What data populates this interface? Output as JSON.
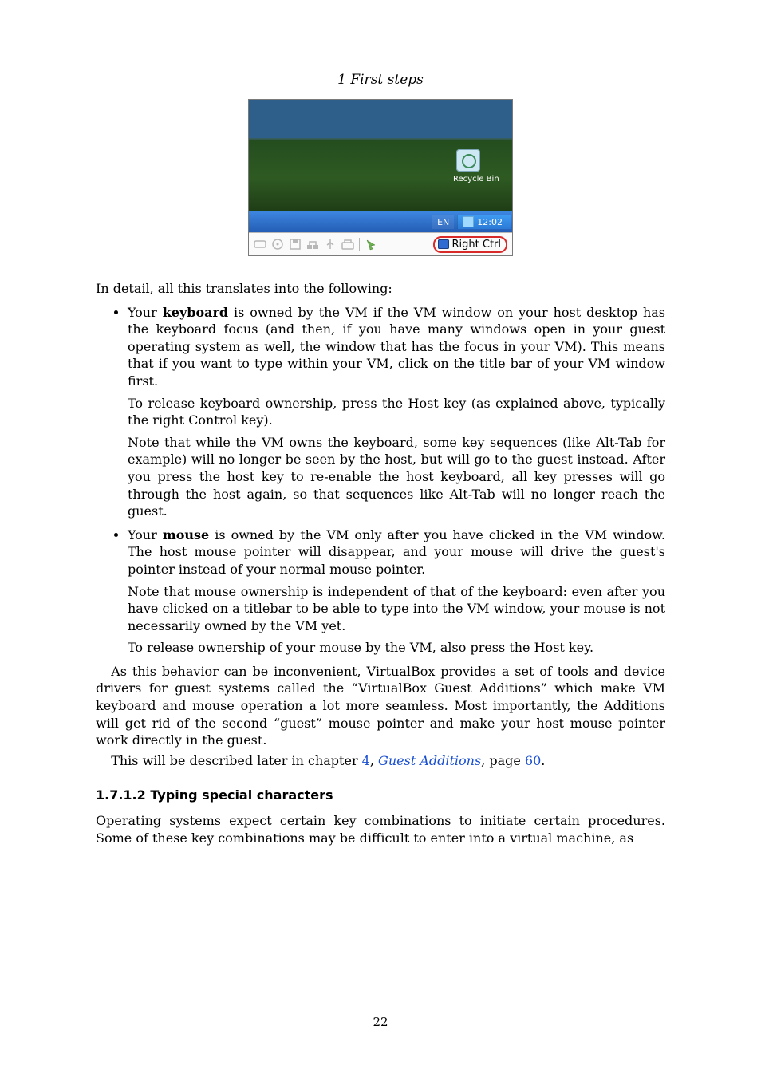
{
  "running_head": "1 First steps",
  "figure": {
    "recycle_label": "Recycle Bin",
    "lang": "EN",
    "clock": "12:02",
    "host_key": "Right Ctrl"
  },
  "intro": "In detail, all this translates into the following:",
  "bullets": {
    "kb": {
      "lead_pre": "Your ",
      "lead_bold": "keyboard",
      "lead_post": " is owned by the VM if the VM window on your host desktop has the keyboard focus (and then, if you have many windows open in your guest operating system as well, the window that has the focus in your VM). This means that if you want to type within your VM, click on the title bar of your VM window first.",
      "p2": "To release keyboard ownership, press the Host key (as explained above, typically the right Control key).",
      "p3": "Note that while the VM owns the keyboard, some key sequences (like Alt-Tab for example) will no longer be seen by the host, but will go to the guest instead. After you press the host key to re-enable the host keyboard, all key presses will go through the host again, so that sequences like Alt-Tab will no longer reach the guest."
    },
    "mouse": {
      "lead_pre": "Your ",
      "lead_bold": "mouse",
      "lead_post": " is owned by the VM only after you have clicked in the VM window. The host mouse pointer will disappear, and your mouse will drive the guest's pointer instead of your normal mouse pointer.",
      "p2": "Note that mouse ownership is independent of that of the keyboard: even after you have clicked on a titlebar to be able to type into the VM window, your mouse is not necessarily owned by the VM yet.",
      "p3": "To release ownership of your mouse by the VM, also press the Host key."
    }
  },
  "after_para1": "As this behavior can be inconvenient, VirtualBox provides a set of tools and device drivers for guest systems called the “VirtualBox Guest Additions” which make VM keyboard and mouse operation a lot more seamless. Most importantly, the Additions will get rid of the second “guest” mouse pointer and make your host mouse pointer work directly in the guest.",
  "after_para2_pre": "This will be described later in chapter ",
  "after_para2_link_ch": "4",
  "after_para2_mid": ", ",
  "after_para2_link_title": "Guest Additions",
  "after_para2_post_mid": ", page ",
  "after_para2_link_page": "60",
  "after_para2_end": ".",
  "section_head": "1.7.1.2 Typing special characters",
  "section_body": "Operating systems expect certain key combinations to initiate certain procedures. Some of these key combinations may be difficult to enter into a virtual machine, as",
  "page_number": "22"
}
